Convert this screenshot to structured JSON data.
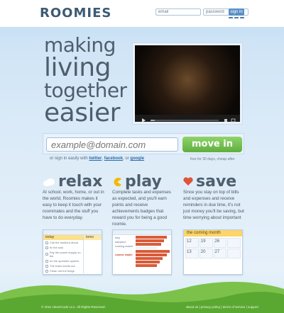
{
  "header": {
    "logo": "ROOMIES",
    "email_placeholder": "email",
    "password_placeholder": "password",
    "signin_label": "sign in",
    "social": [
      "facebook-icon",
      "twitter-icon",
      "google-icon"
    ]
  },
  "hero": {
    "lines": [
      "making",
      "living",
      "together",
      "easier"
    ],
    "video_caption": "free for 30 days, cheap after"
  },
  "signup": {
    "email_placeholder": "example@domain.com",
    "button_label": "move in",
    "alt_prefix": "or sign in easily with",
    "twitter": "twitter",
    "facebook": "facebook",
    "or": ", or",
    "google": "google",
    "free_note": "free for 30 days, cheap after"
  },
  "features": [
    {
      "title": "relax",
      "icon": "cloud-icon",
      "text": "At school, work, home, or out in the world, Roomies makes it easy to keep it touch with your roommates and the stuff you have to do everyday."
    },
    {
      "title": "play",
      "icon": "pacman-icon",
      "text": "Complete tasks and expenses as expected, and you'll earn points and receive achievements badges that reward you for being a good roomie."
    },
    {
      "title": "save",
      "icon": "heart-icon",
      "text": "Since you stay on top of bills and expenses and receive reminders in due time, it's not just money you'll be saving, but time worrying about important"
    }
  ],
  "cards": {
    "tasks": {
      "bar": "",
      "today": "today",
      "tomorrow": "tomo",
      "rows": [
        "Call the landlord about",
        "fix the sink",
        "Pay the power supply on the",
        "do the sprinkler system",
        "The trash needs out",
        "Clean out the fridge"
      ]
    },
    "points": {
      "labels": [
        "toby",
        "babyface",
        "cooking master",
        "",
        "roomie leader"
      ]
    },
    "calendar": {
      "heading": "the coming month",
      "days": [
        "12",
        "19",
        "26",
        "",
        "13",
        "20",
        "27",
        ""
      ]
    }
  },
  "footer": {
    "copyright": "© 2011 cleverCode LLC. All Rights Reserved.",
    "links": "about us | privacy policy | terms of service | support"
  },
  "colors": {
    "accent": "#5fae3f",
    "brand": "#3d5a73",
    "bar": "#d95b3a",
    "calendar": "#fcd46a"
  }
}
